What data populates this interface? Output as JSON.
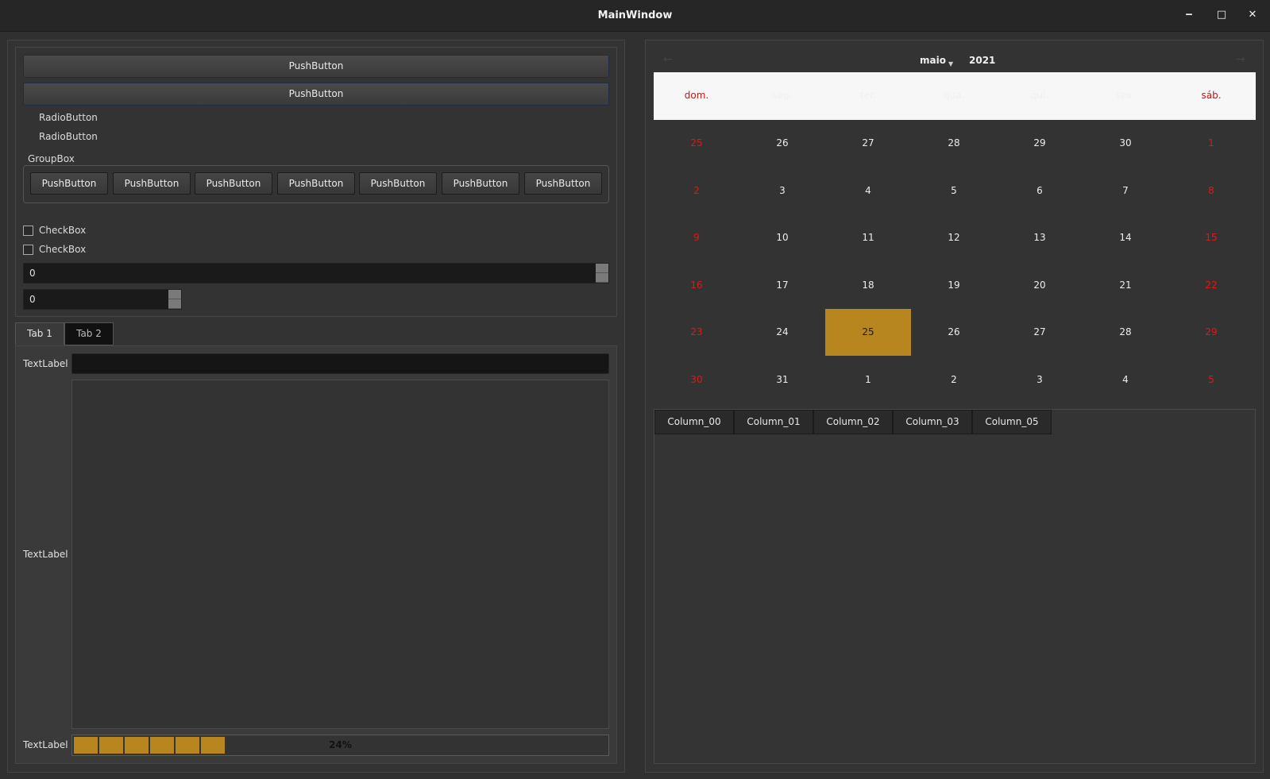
{
  "window": {
    "title": "MainWindow"
  },
  "controls": {
    "minimize_glyph": "‒",
    "maximize_glyph": "□",
    "close_glyph": "✕"
  },
  "buttons": {
    "push1": "PushButton",
    "push2": "PushButton"
  },
  "radios": [
    "RadioButton",
    "RadioButton"
  ],
  "groupbox": {
    "title": "GroupBox",
    "buttons": [
      "PushButton",
      "PushButton",
      "PushButton",
      "PushButton",
      "PushButton",
      "PushButton",
      "PushButton"
    ]
  },
  "checkboxes": [
    "CheckBox",
    "CheckBox"
  ],
  "spinboxes": {
    "wide": "0",
    "narrow": "0"
  },
  "tabs": [
    {
      "label": "Tab 1",
      "active": true
    },
    {
      "label": "Tab 2",
      "active": false
    }
  ],
  "tab_content": {
    "label1": "TextLabel",
    "label2": "TextLabel",
    "label3": "TextLabel",
    "progress": {
      "value": 0.24,
      "text": "24%"
    }
  },
  "calendar": {
    "month": "maio",
    "year": "2021",
    "weekdays": [
      "dom.",
      "seg.",
      "ter.",
      "qua.",
      "qui.",
      "sex.",
      "sáb."
    ],
    "weeks": [
      [
        "25",
        "26",
        "27",
        "28",
        "29",
        "30",
        "1"
      ],
      [
        "2",
        "3",
        "4",
        "5",
        "6",
        "7",
        "8"
      ],
      [
        "9",
        "10",
        "11",
        "12",
        "13",
        "14",
        "15"
      ],
      [
        "16",
        "17",
        "18",
        "19",
        "20",
        "21",
        "22"
      ],
      [
        "23",
        "24",
        "25",
        "26",
        "27",
        "28",
        "29"
      ],
      [
        "30",
        "31",
        "1",
        "2",
        "3",
        "4",
        "5"
      ]
    ],
    "selected_day": "25",
    "accent_color": "#b8861f",
    "weekend_color": "#d01010"
  },
  "table": {
    "columns": [
      "Column_00",
      "Column_01",
      "Column_02",
      "Column_03",
      "Column_05"
    ]
  }
}
